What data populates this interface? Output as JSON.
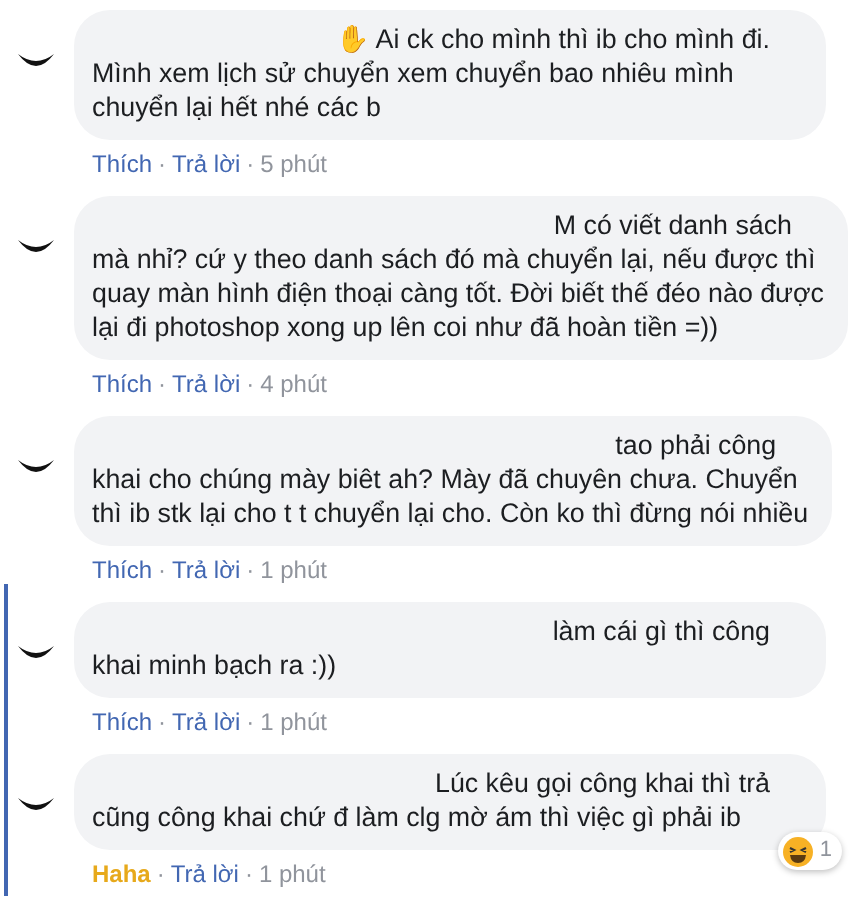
{
  "comments": [
    {
      "lines": [
        "✋ Ai ck cho mình thì ib cho mình đi.",
        "Mình xem lịch sử chuyển xem chuyển bao nhiêu mình",
        "chuyển lại hết nhé các b"
      ],
      "reaction": {
        "label": "Thích",
        "selected": false
      },
      "separator": "·",
      "reply": "Trả lời",
      "time": "5 phút",
      "highlighted": false
    },
    {
      "lines": [
        "M có viết danh sách",
        "mà nhỉ? cứ y theo danh sách đó mà chuyển lại, nếu được thì",
        "quay màn hình điện thoại càng tốt. Đời biết thế đéo nào được",
        "lại đi photoshop xong up lên coi như đã hoàn tiền =))"
      ],
      "reaction": {
        "label": "Thích",
        "selected": false
      },
      "separator": "·",
      "reply": "Trả lời",
      "time": "4 phút",
      "highlighted": false
    },
    {
      "lines": [
        "tao phải công",
        "khai cho chúng mày biêt ah? Mày đã chuyên chưa. Chuyển",
        "thì ib stk lại cho t t chuyển lại cho. Còn ko thì đừng nói nhiều"
      ],
      "reaction": {
        "label": "Thích",
        "selected": false
      },
      "separator": "·",
      "reply": "Trả lời",
      "time": "1 phút",
      "highlighted": false
    },
    {
      "lines": [
        "làm cái gì thì công",
        "khai minh bạch ra :))"
      ],
      "reaction": {
        "label": "Thích",
        "selected": false
      },
      "separator": "·",
      "reply": "Trả lời",
      "time": "1 phút",
      "highlighted": true
    },
    {
      "lines": [
        "Lúc kêu gọi công khai thì trả",
        "cũng công khai chứ đ làm clg mờ ám thì việc gì phải ib"
      ],
      "reaction": {
        "label": "Haha",
        "selected": true
      },
      "separator": "·",
      "reply": "Trả lời",
      "time": "1 phút",
      "highlighted": true,
      "badge": {
        "count": "1"
      }
    }
  ]
}
